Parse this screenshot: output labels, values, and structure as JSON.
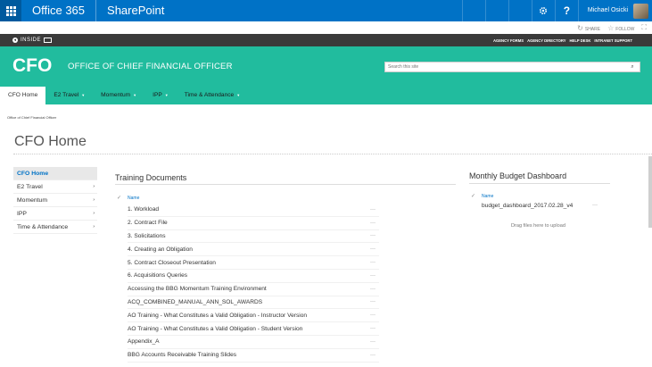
{
  "suite": {
    "app_name": "Office 365",
    "product": "SharePoint",
    "settings_icon": "gear-icon",
    "help_label": "?",
    "user_name": "Michael Osicki"
  },
  "actions": {
    "share": "SHARE",
    "follow": "FOLLOW"
  },
  "inside": {
    "logo_text": "INSIDE",
    "links": [
      "AGENCY FORMS",
      "AGENCY DIRECTORY",
      "HELP DESK",
      "INTRANET SUPPORT"
    ]
  },
  "banner": {
    "logo": "CFO",
    "title": "OFFICE OF CHIEF FINANCIAL OFFICER",
    "search_placeholder": "Search this site",
    "accent_color": "#21bc9e"
  },
  "topnav": [
    {
      "label": "CFO Home",
      "dropdown": false
    },
    {
      "label": "E2 Travel",
      "dropdown": true
    },
    {
      "label": "Momentum",
      "dropdown": true
    },
    {
      "label": "IPP",
      "dropdown": true
    },
    {
      "label": "Time & Attendance",
      "dropdown": true
    }
  ],
  "breadcrumb": "Office of Chief Financial Officer",
  "page_title": "CFO Home",
  "leftnav": [
    {
      "label": "CFO Home",
      "arrow": ""
    },
    {
      "label": "E2 Travel",
      "arrow": "›"
    },
    {
      "label": "Momentum",
      "arrow": "›"
    },
    {
      "label": "IPP",
      "arrow": "›"
    },
    {
      "label": "Time & Attendance",
      "arrow": "›"
    }
  ],
  "training": {
    "title": "Training Documents",
    "column": "Name",
    "items": [
      "1. Workload",
      "2. Contract File",
      "3. Solicitations",
      "4. Creating an Obligation",
      "5. Contract Closeout Presentation",
      "6. Acquisitions Queries",
      "Accessing the BBG Momentum Training Environment",
      "ACQ_COMBINED_MANUAL_ANN_SOL_AWARDS",
      "AO Training - What Constitutes a Valid Obligation - Instructor Version",
      "AO Training - What Constitutes a Valid Obligation - Student Version",
      "Appendix_A",
      "BBG Accounts Receivable Training Slides"
    ]
  },
  "budget": {
    "title": "Monthly Budget Dashboard",
    "column": "Name",
    "file": "budget_dashboard_2017.02.28_v4",
    "drop_text": "Drag files here to upload"
  },
  "ellipsis": "···"
}
